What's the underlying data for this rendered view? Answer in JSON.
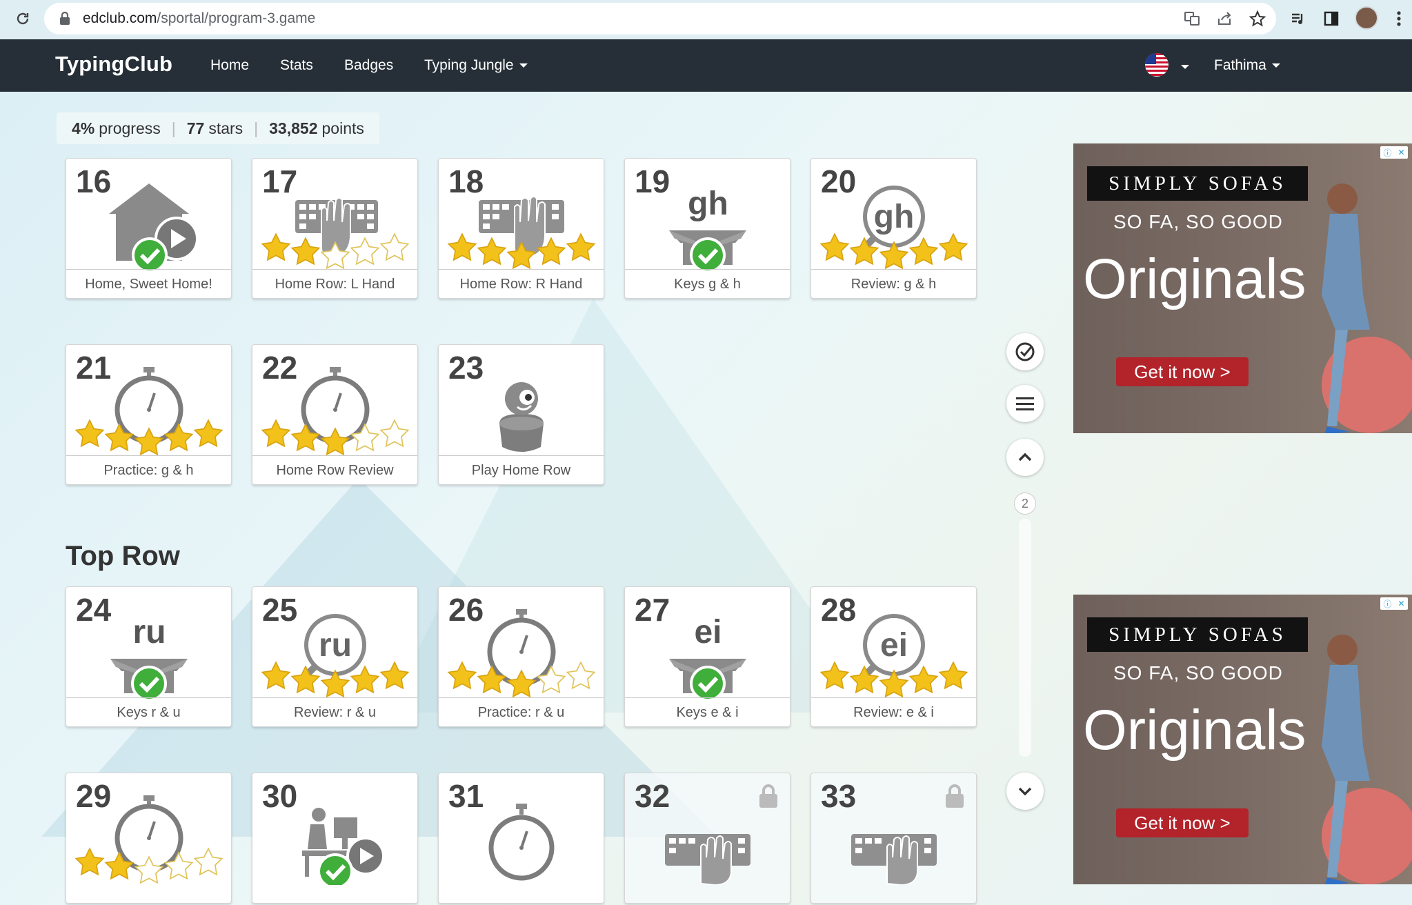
{
  "browser": {
    "url_host": "edclub.com",
    "url_path": "/sportal/program-3.game"
  },
  "nav": {
    "brand": "TypingClub",
    "links": [
      "Home",
      "Stats",
      "Badges",
      "Typing Jungle"
    ],
    "user": "Fathima"
  },
  "progress": {
    "percent": "4%",
    "percent_label": "progress",
    "stars": "77",
    "stars_label": "stars",
    "points": "33,852",
    "points_label": "points"
  },
  "lessons": [
    {
      "num": "16",
      "label": "Home, Sweet Home!",
      "icon": "home-video-icon",
      "status": "completed",
      "stars": null
    },
    {
      "num": "17",
      "label": "Home Row: L Hand",
      "icon": "keyboard-left-hand-icon",
      "status": "stars",
      "stars": 2
    },
    {
      "num": "18",
      "label": "Home Row: R Hand",
      "icon": "keyboard-right-hand-icon",
      "status": "stars",
      "stars": 5
    },
    {
      "num": "19",
      "label": "Keys g & h",
      "icon": "gh-box-icon",
      "letters": "gh",
      "status": "completed",
      "stars": null
    },
    {
      "num": "20",
      "label": "Review: g & h",
      "icon": "gh-magnifier-icon",
      "letters": "gh",
      "status": "stars",
      "stars": 5
    },
    {
      "num": "21",
      "label": "Practice: g & h",
      "icon": "stopwatch-icon",
      "status": "stars",
      "stars": 5
    },
    {
      "num": "22",
      "label": "Home Row Review",
      "icon": "stopwatch-icon",
      "status": "stars",
      "stars": 3
    },
    {
      "num": "23",
      "label": "Play Home Row",
      "icon": "game-character-icon",
      "status": "none",
      "stars": null
    },
    {
      "num": "24",
      "label": "Keys r & u",
      "icon": "ru-box-icon",
      "letters": "ru",
      "status": "completed",
      "stars": null
    },
    {
      "num": "25",
      "label": "Review: r & u",
      "icon": "ru-magnifier-icon",
      "letters": "ru",
      "status": "stars",
      "stars": 5
    },
    {
      "num": "26",
      "label": "Practice: r & u",
      "icon": "stopwatch-icon",
      "status": "stars",
      "stars": 3
    },
    {
      "num": "27",
      "label": "Keys e & i",
      "icon": "ei-box-icon",
      "letters": "ei",
      "status": "completed",
      "stars": null
    },
    {
      "num": "28",
      "label": "Review: e & i",
      "icon": "ei-magnifier-icon",
      "letters": "ei",
      "status": "stars",
      "stars": 5
    },
    {
      "num": "29",
      "label": "",
      "icon": "stopwatch-icon",
      "status": "stars",
      "stars": 2
    },
    {
      "num": "30",
      "label": "",
      "icon": "typist-video-icon",
      "status": "completed",
      "stars": null
    },
    {
      "num": "31",
      "label": "",
      "icon": "stopwatch-icon",
      "status": "none",
      "stars": null
    },
    {
      "num": "32",
      "label": "",
      "icon": "keyboard-hand-icon",
      "status": "locked",
      "stars": null
    },
    {
      "num": "33",
      "label": "",
      "icon": "keyboard-hand-icon",
      "status": "locked",
      "stars": null
    }
  ],
  "section_title": "Top Row",
  "page_indicator": "2",
  "ads": [
    {
      "brand": "SIMPLY SOFAS",
      "tagline": "SO FA, SO GOOD",
      "headline": "Originals",
      "cta": "Get it now >"
    },
    {
      "brand": "SIMPLY SOFAS",
      "tagline": "SO FA, SO GOOD",
      "headline": "Originals",
      "cta": "Get it now >"
    }
  ],
  "colors": {
    "navbar": "#262f37",
    "star": "#f2c21b",
    "check": "#3fae3a",
    "ad_cta": "#b2232a"
  }
}
